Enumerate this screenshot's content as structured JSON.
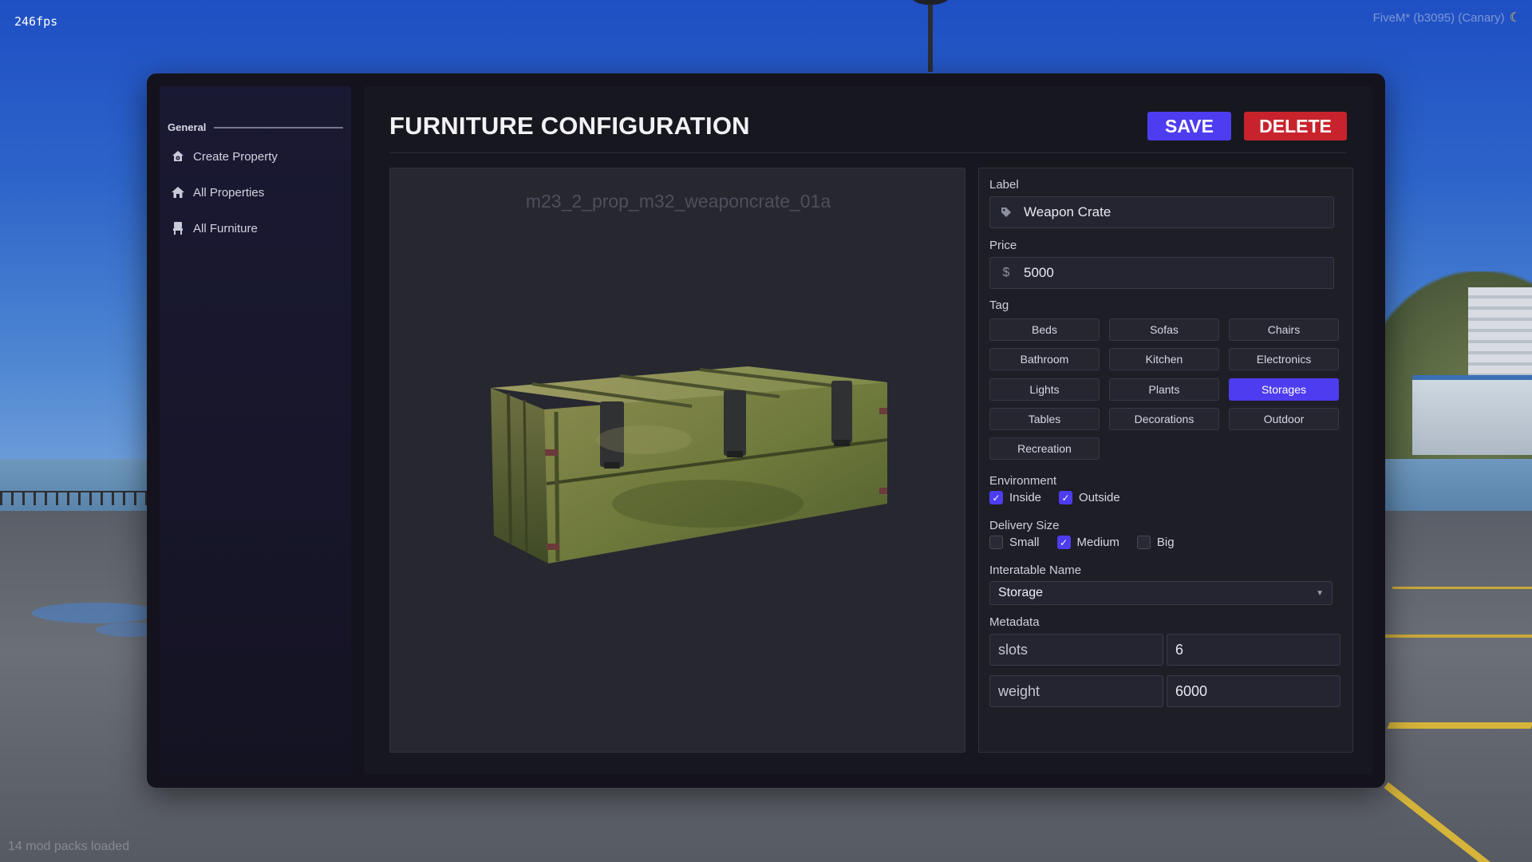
{
  "overlay": {
    "fps": "246fps",
    "build": "FiveM* (b3095) (Canary)",
    "mods": "14 mod packs loaded"
  },
  "sidebar": {
    "heading": "General",
    "items": [
      {
        "label": "Create Property",
        "icon": "house-gear-icon"
      },
      {
        "label": "All Properties",
        "icon": "house-icon"
      },
      {
        "label": "All Furniture",
        "icon": "chair-icon"
      }
    ]
  },
  "header": {
    "title": "FURNITURE CONFIGURATION",
    "save_label": "SAVE",
    "delete_label": "DELETE"
  },
  "preview": {
    "model_name": "m23_2_prop_m32_weaponcrate_01a"
  },
  "form": {
    "label_title": "Label",
    "label_value": "Weapon Crate",
    "price_title": "Price",
    "price_prefix": "$",
    "price_value": "5000",
    "tag_title": "Tag",
    "tags": [
      "Beds",
      "Sofas",
      "Chairs",
      "Bathroom",
      "Kitchen",
      "Electronics",
      "Lights",
      "Plants",
      "Storages",
      "Tables",
      "Decorations",
      "Outdoor",
      "Recreation"
    ],
    "selected_tag": "Storages",
    "environment_title": "Environment",
    "environment": [
      {
        "label": "Inside",
        "checked": true
      },
      {
        "label": "Outside",
        "checked": true
      }
    ],
    "delivery_title": "Delivery Size",
    "delivery": [
      {
        "label": "Small",
        "checked": false
      },
      {
        "label": "Medium",
        "checked": true
      },
      {
        "label": "Big",
        "checked": false
      }
    ],
    "interactable_title": "Interatable Name",
    "interactable_value": "Storage",
    "metadata_title": "Metadata",
    "metadata": [
      {
        "key": "slots",
        "value": "6"
      },
      {
        "key": "weight",
        "value": "6000"
      }
    ]
  },
  "colors": {
    "accent": "#4e3cf0",
    "danger": "#c8232d",
    "panel": "#17171f"
  }
}
